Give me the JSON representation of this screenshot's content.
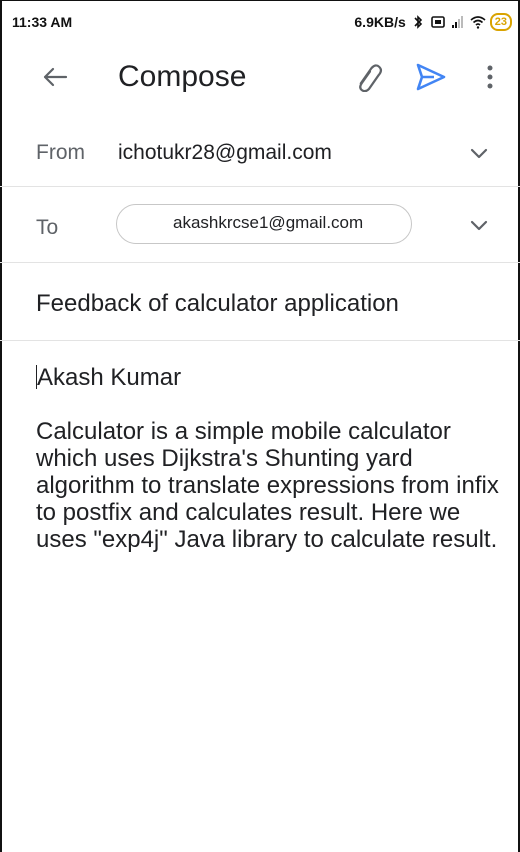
{
  "status_bar": {
    "time": "11:33 AM",
    "net_speed": "6.9KB/s",
    "battery": "23"
  },
  "app_bar": {
    "title": "Compose",
    "icons": [
      "back-arrow-icon",
      "attach-icon",
      "send-icon",
      "more-vert-icon"
    ],
    "accent_color": "#4285f4"
  },
  "from": {
    "label": "From",
    "value": "ichotukr28@gmail.com"
  },
  "to": {
    "label": "To",
    "recipient": "akashkrcse1@gmail.com"
  },
  "subject": "Feedback of calculator application",
  "body": {
    "greeting": "Akash Kumar",
    "paragraph": "Calculator is a simple mobile calculator which uses Dijkstra's Shunting yard algorithm to translate expressions from infix to postfix and calculates result. Here we uses \"exp4j\" Java library to calculate result."
  }
}
